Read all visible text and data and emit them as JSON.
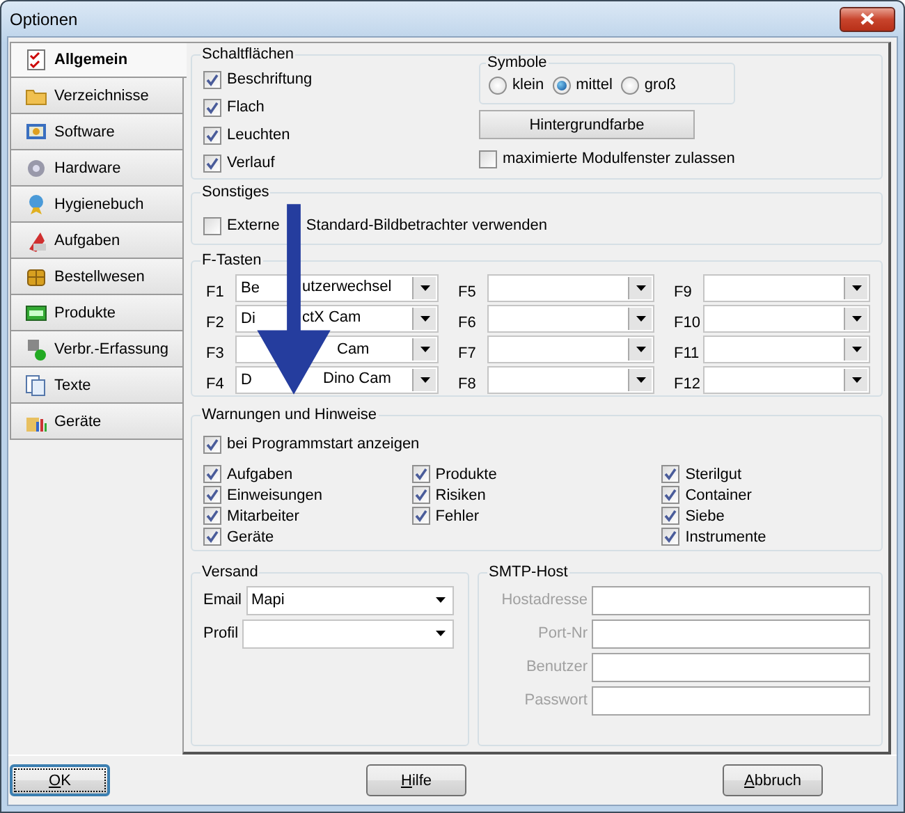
{
  "window": {
    "title": "Optionen"
  },
  "tabs": [
    {
      "label": "Allgemein",
      "selected": true
    },
    {
      "label": "Verzeichnisse",
      "selected": false
    },
    {
      "label": "Software",
      "selected": false
    },
    {
      "label": "Hardware",
      "selected": false
    },
    {
      "label": "Hygienebuch",
      "selected": false
    },
    {
      "label": "Aufgaben",
      "selected": false
    },
    {
      "label": "Bestellwesen",
      "selected": false
    },
    {
      "label": "Produkte",
      "selected": false
    },
    {
      "label": "Verbr.-Erfassung",
      "selected": false
    },
    {
      "label": "Texte",
      "selected": false
    },
    {
      "label": "Geräte",
      "selected": false
    }
  ],
  "button_options": {
    "title": "Schaltflächen",
    "checkboxes": [
      {
        "label": "Beschriftung",
        "checked": true
      },
      {
        "label": "Flach",
        "checked": true
      },
      {
        "label": "Leuchten",
        "checked": true
      },
      {
        "label": "Verlauf",
        "checked": true
      }
    ],
    "symbols": {
      "title": "Symbole",
      "options": [
        {
          "label": "klein",
          "selected": false
        },
        {
          "label": "mittel",
          "selected": true
        },
        {
          "label": "groß",
          "selected": false
        }
      ]
    },
    "color_button": "Hintergrundfarbe",
    "maximize": {
      "label": "maximierte Modulfenster zulassen",
      "checked": false
    }
  },
  "misc": {
    "title": "Sonstiges",
    "checkbox": {
      "label_parts": [
        "Externe",
        "Standard-Bildbetrachter verwenden"
      ],
      "checked": false
    }
  },
  "function_keys": {
    "title": "F-Tasten",
    "keys": [
      {
        "key": "F1",
        "value_parts": [
          "Be",
          "utzerwechsel"
        ]
      },
      {
        "key": "F2",
        "value_parts": [
          "Di",
          "ctX Cam"
        ]
      },
      {
        "key": "F3",
        "value_parts": [
          "Cam"
        ]
      },
      {
        "key": "F4",
        "value_parts": [
          "D",
          "Dino Cam"
        ]
      },
      {
        "key": "F5"
      },
      {
        "key": "F6"
      },
      {
        "key": "F7"
      },
      {
        "key": "F8"
      },
      {
        "key": "F9"
      },
      {
        "key": "F10"
      },
      {
        "key": "F11"
      },
      {
        "key": "F12"
      }
    ]
  },
  "warnings": {
    "title": "Warnungen und Hinweise",
    "show_on_start": {
      "label": "bei Programmstart anzeigen",
      "checked": true
    },
    "columns": [
      [
        {
          "label": "Aufgaben",
          "checked": true
        },
        {
          "label": "Einweisungen",
          "checked": true
        },
        {
          "label": "Mitarbeiter",
          "checked": true
        },
        {
          "label": "Geräte",
          "checked": true
        }
      ],
      [
        {
          "label": "Produkte",
          "checked": true
        },
        {
          "label": "Risiken",
          "checked": true
        },
        {
          "label": "Fehler",
          "checked": true
        }
      ],
      [
        {
          "label": "Sterilgut",
          "checked": true
        },
        {
          "label": "Container",
          "checked": true
        },
        {
          "label": "Siebe",
          "checked": true
        },
        {
          "label": "Instrumente",
          "checked": true
        }
      ]
    ]
  },
  "mail": {
    "title": "Versand",
    "fields": [
      {
        "label": "Email",
        "value": "Mapi"
      },
      {
        "label": "Profil"
      }
    ]
  },
  "smtp": {
    "title": "SMTP-Host",
    "disabled": true,
    "fields": [
      {
        "label": "Hostadresse"
      },
      {
        "label": "Port-Nr"
      },
      {
        "label": "Benutzer"
      },
      {
        "label": "Passwort"
      }
    ]
  },
  "footer_buttons": [
    {
      "label": "OK",
      "default": true
    },
    {
      "label": "Hilfe",
      "default": false
    },
    {
      "label": "Abbruch",
      "default": false
    }
  ],
  "annotation": {
    "kind": "arrow"
  }
}
